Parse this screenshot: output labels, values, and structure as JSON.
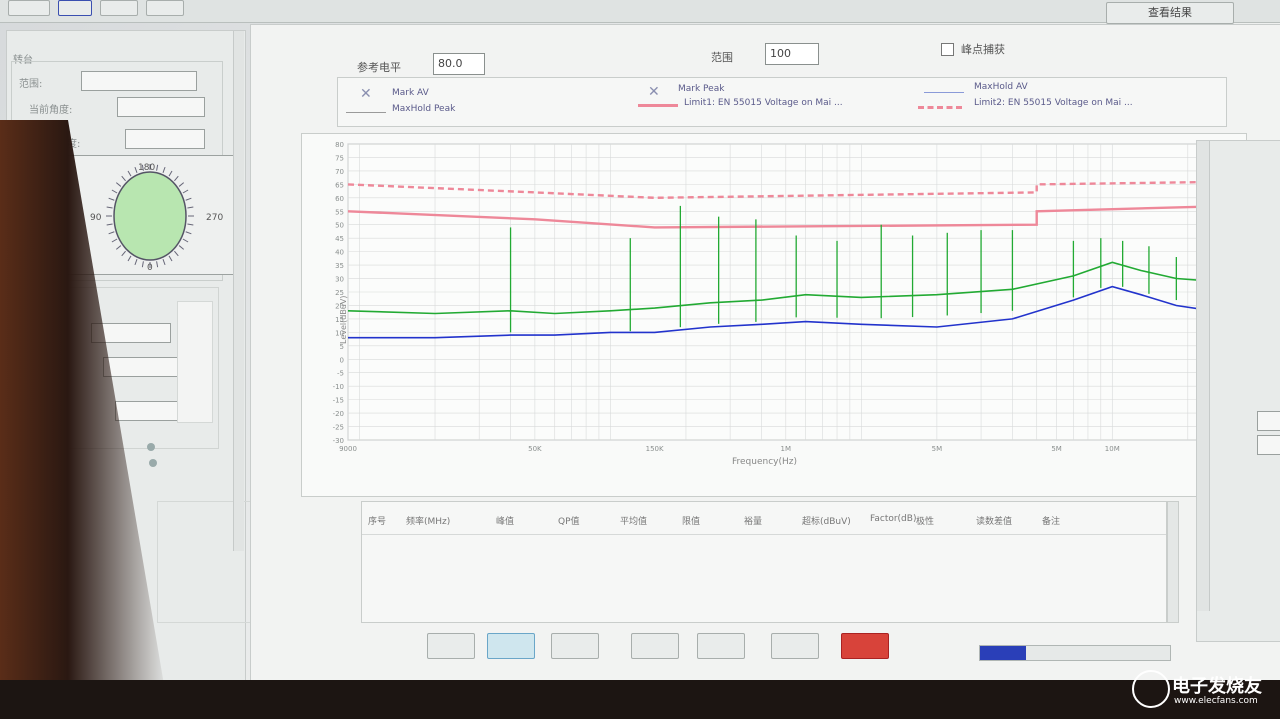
{
  "toolbar": {
    "view_button_label": "查看结果"
  },
  "left_panel": {
    "section_title": "转台",
    "fields": [
      {
        "label": "范围:"
      },
      {
        "label": "当前角度:"
      },
      {
        "label": "目标角度:"
      }
    ],
    "dial_labels": {
      "top": "180",
      "left": "90",
      "right": "270",
      "bottom": "0"
    }
  },
  "controls": {
    "ref_level_label": "参考电平",
    "ref_level_value": "80.0",
    "range_label": "范围",
    "range_value": "100",
    "checkbox_label": "峰点捕获"
  },
  "legend": {
    "items": [
      {
        "label": "Mark AV"
      },
      {
        "label": "MaxHold Peak"
      },
      {
        "label": "Mark Peak"
      },
      {
        "label": "Limit1: EN 55015 Voltage on Mai ..."
      },
      {
        "label": "MaxHold AV"
      },
      {
        "label": "Limit2: EN 55015 Voltage on Mai ..."
      }
    ]
  },
  "colors": {
    "peak": "#22aa33",
    "av": "#2233cc",
    "limit": "#ee8899",
    "grid": "#d8dada"
  },
  "chart_data": {
    "type": "line",
    "xlabel": "Frequency(Hz)",
    "ylabel": "Level(dBuV)",
    "x_scale": "log",
    "xlim_hz": [
      9000,
      30000000
    ],
    "ylim": [
      -30,
      80
    ],
    "x_ticks": [
      {
        "hz": 9000,
        "label": "9000"
      },
      {
        "hz": 50000,
        "label": "50K"
      },
      {
        "hz": 150000,
        "label": "150K"
      },
      {
        "hz": 500000,
        "label": "1M"
      },
      {
        "hz": 2000000,
        "label": "5M"
      },
      {
        "hz": 6000000,
        "label": "5M"
      },
      {
        "hz": 10000000,
        "label": "10M"
      },
      {
        "hz": 30000000,
        "label": "30.0M"
      }
    ],
    "y_ticks": [
      80,
      75,
      70,
      65,
      60,
      55,
      50,
      45,
      40,
      35,
      30,
      25,
      20,
      15,
      10,
      5,
      0,
      -5,
      -10,
      -15,
      -20,
      -25,
      -30
    ],
    "series": [
      {
        "name": "Limit1: EN 55015 Voltage on Mai",
        "style": "solid",
        "points": [
          [
            9000,
            55
          ],
          [
            50000,
            52
          ],
          [
            150000,
            49
          ],
          [
            5000000,
            50
          ],
          [
            5000000,
            55
          ],
          [
            30000000,
            57
          ]
        ]
      },
      {
        "name": "Limit2: EN 55015 Voltage on Mai",
        "style": "dashed",
        "points": [
          [
            9000,
            65
          ],
          [
            50000,
            62
          ],
          [
            150000,
            60
          ],
          [
            5000000,
            62
          ],
          [
            5000000,
            65
          ],
          [
            30000000,
            66
          ]
        ]
      },
      {
        "name": "MaxHold Peak",
        "style": "solid",
        "points": [
          [
            9000,
            18
          ],
          [
            20000,
            17
          ],
          [
            40000,
            18
          ],
          [
            60000,
            17
          ],
          [
            100000,
            18
          ],
          [
            150000,
            19
          ],
          [
            250000,
            21
          ],
          [
            400000,
            22
          ],
          [
            600000,
            24
          ],
          [
            1000000,
            23
          ],
          [
            2000000,
            24
          ],
          [
            4000000,
            26
          ],
          [
            7000000,
            31
          ],
          [
            10000000,
            36
          ],
          [
            13000000,
            33
          ],
          [
            18000000,
            30
          ],
          [
            25000000,
            29
          ]
        ]
      },
      {
        "name": "MaxHold AV",
        "style": "solid",
        "points": [
          [
            9000,
            8
          ],
          [
            20000,
            8
          ],
          [
            40000,
            9
          ],
          [
            60000,
            9
          ],
          [
            100000,
            10
          ],
          [
            150000,
            10
          ],
          [
            250000,
            12
          ],
          [
            400000,
            13
          ],
          [
            600000,
            14
          ],
          [
            1000000,
            13
          ],
          [
            2000000,
            12
          ],
          [
            4000000,
            15
          ],
          [
            7000000,
            22
          ],
          [
            10000000,
            27
          ],
          [
            13000000,
            24
          ],
          [
            18000000,
            20
          ],
          [
            25000000,
            18
          ]
        ]
      }
    ],
    "spikes": [
      [
        40000,
        49
      ],
      [
        120000,
        45
      ],
      [
        190000,
        57
      ],
      [
        270000,
        53
      ],
      [
        380000,
        52
      ],
      [
        550000,
        46
      ],
      [
        800000,
        44
      ],
      [
        1200000,
        50
      ],
      [
        1600000,
        46
      ],
      [
        2200000,
        47
      ],
      [
        3000000,
        48
      ],
      [
        4000000,
        48
      ],
      [
        7000000,
        44
      ],
      [
        9000000,
        45
      ],
      [
        11000000,
        44
      ],
      [
        14000000,
        42
      ],
      [
        18000000,
        38
      ],
      [
        22000000,
        36
      ]
    ]
  },
  "result_table": {
    "headers": [
      "序号",
      "频率(MHz)",
      "峰值",
      "QP值",
      "平均值",
      "限值",
      "裕量",
      "超标(dBuV)",
      "Factor(dB)",
      "极性",
      "读数差值",
      "备注"
    ]
  },
  "watermark": {
    "text": "电子发烧友",
    "site": "www.elecfans.com"
  }
}
